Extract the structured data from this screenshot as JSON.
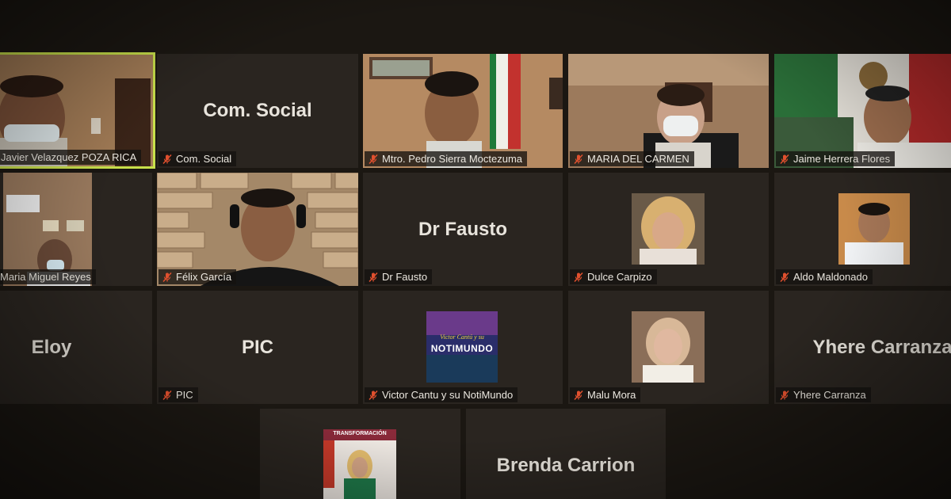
{
  "participants": [
    {
      "name": "Javier Velazquez POZA RICA",
      "video": true,
      "muted": false,
      "active": true
    },
    {
      "name": "Com. Social",
      "video": false,
      "muted": true
    },
    {
      "name": "Mtro. Pedro Sierra Moctezuma",
      "video": true,
      "muted": true
    },
    {
      "name": "MARIA DEL CARMEN",
      "video": true,
      "muted": true
    },
    {
      "name": "Jaime Herrera Flores",
      "video": true,
      "muted": true
    },
    {
      "name": "Maria Miguel Reyes",
      "video": true,
      "muted": false
    },
    {
      "name": "Félix García",
      "video": true,
      "muted": true
    },
    {
      "name": "Dr Fausto",
      "video": false,
      "muted": true
    },
    {
      "name": "Dulce Carpizo",
      "video": false,
      "photo": true,
      "muted": true
    },
    {
      "name": "Aldo Maldonado",
      "video": false,
      "photo": true,
      "muted": true
    },
    {
      "name": "Eloy",
      "video": false,
      "muted": false
    },
    {
      "name": "PIC",
      "video": false,
      "muted": true
    },
    {
      "name": "Victor Cantu y su NotiMundo",
      "video": false,
      "photo": true,
      "muted": true
    },
    {
      "name": "Malu Mora",
      "video": false,
      "photo": true,
      "muted": true
    },
    {
      "name": "Yhere Carranza",
      "video": false,
      "muted": true
    },
    {
      "name": "",
      "video": false,
      "photo": true,
      "muted": false
    },
    {
      "name": "Brenda Carrion",
      "video": false,
      "muted": false
    }
  ],
  "labels": {
    "javier": "Javier Velazquez POZA RICA",
    "comsocial": "Com. Social",
    "pedro": "Mtro. Pedro Sierra Moctezuma",
    "maria_carmen": "MARIA DEL CARMEN",
    "jaime": "Jaime Herrera Flores",
    "maria_miguel": "Maria Miguel Reyes",
    "felix": "Félix García",
    "fausto": "Dr Fausto",
    "dulce": "Dulce Carpizo",
    "aldo": "Aldo Maldonado",
    "eloy": "Eloy",
    "pic": "PIC",
    "victor": "Victor Cantu y su NotiMundo",
    "malu": "Malu Mora",
    "yhere": "Yhere Carranza",
    "brenda": "Brenda Carrion"
  },
  "logo_text": {
    "line1": "Victor Cantú y su",
    "line2": "NOTIMUNDO"
  },
  "poster_text": "TRANSFORMACIÓN",
  "colors": {
    "active_border": "#c8e04a",
    "mic_muted": "#e0502e",
    "tile_bg": "#2a2520"
  }
}
